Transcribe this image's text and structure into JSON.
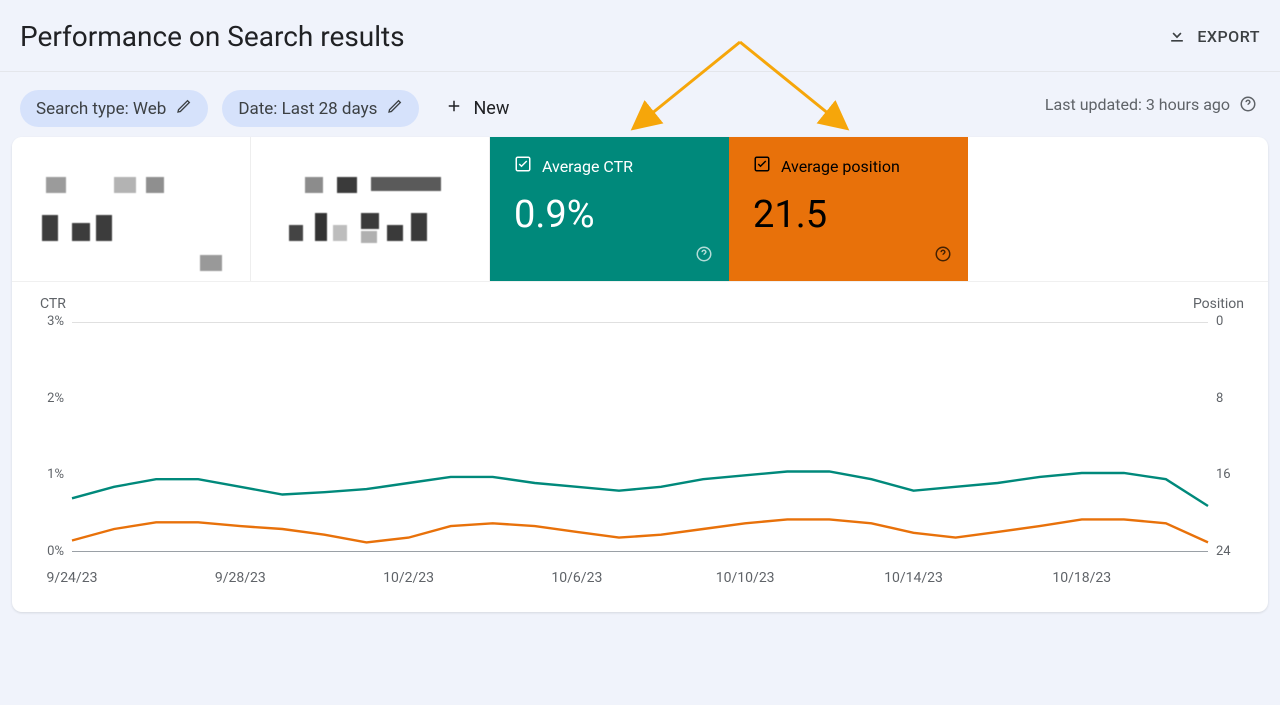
{
  "header": {
    "title": "Performance on Search results",
    "export_label": "EXPORT"
  },
  "filter_chips": {
    "search_type_label": "Search type: Web",
    "date_label": "Date: Last 28 days",
    "new_label": "New"
  },
  "status": {
    "last_updated": "Last updated: 3 hours ago"
  },
  "tiles": {
    "ctr": {
      "label": "Average CTR",
      "value": "0.9%"
    },
    "position": {
      "label": "Average position",
      "value": "21.5"
    }
  },
  "axis": {
    "left_label": "CTR",
    "right_label": "Position",
    "left_ticks": [
      "3%",
      "2%",
      "1%",
      "0%"
    ],
    "right_ticks": [
      "0",
      "8",
      "16",
      "24"
    ]
  },
  "chart_data": {
    "type": "line",
    "xlabel": "",
    "ylabel_left": "CTR",
    "ylabel_right": "Position",
    "ylim_left": [
      0,
      3
    ],
    "ylim_right_inverted": [
      24,
      0
    ],
    "categories": [
      "9/24/23",
      "9/25/23",
      "9/26/23",
      "9/27/23",
      "9/28/23",
      "9/29/23",
      "9/30/23",
      "10/1/23",
      "10/2/23",
      "10/3/23",
      "10/4/23",
      "10/5/23",
      "10/6/23",
      "10/7/23",
      "10/8/23",
      "10/9/23",
      "10/10/23",
      "10/11/23",
      "10/12/23",
      "10/13/23",
      "10/14/23",
      "10/15/23",
      "10/16/23",
      "10/17/23",
      "10/18/23",
      "10/19/23",
      "10/20/23",
      "10/21/23"
    ],
    "x_tick_labels": [
      "9/24/23",
      "9/28/23",
      "10/2/23",
      "10/6/23",
      "10/10/23",
      "10/14/23",
      "10/18/23"
    ],
    "series": [
      {
        "name": "Average CTR",
        "axis": "left",
        "color": "#00897b",
        "values": [
          0.7,
          0.85,
          0.95,
          0.95,
          0.85,
          0.75,
          0.78,
          0.82,
          0.9,
          0.98,
          0.98,
          0.9,
          0.85,
          0.8,
          0.85,
          0.95,
          1.0,
          1.05,
          1.05,
          0.95,
          0.8,
          0.85,
          0.9,
          0.98,
          1.03,
          1.03,
          0.95,
          0.6
        ]
      },
      {
        "name": "Average position",
        "axis": "right",
        "color": "#e8710a",
        "values": [
          22.8,
          21.6,
          20.9,
          20.9,
          21.3,
          21.6,
          22.2,
          23.0,
          22.5,
          21.3,
          21.0,
          21.3,
          21.9,
          22.5,
          22.2,
          21.6,
          21.0,
          20.6,
          20.6,
          21.0,
          22.0,
          22.5,
          21.9,
          21.3,
          20.6,
          20.6,
          21.0,
          23.0
        ]
      }
    ]
  }
}
